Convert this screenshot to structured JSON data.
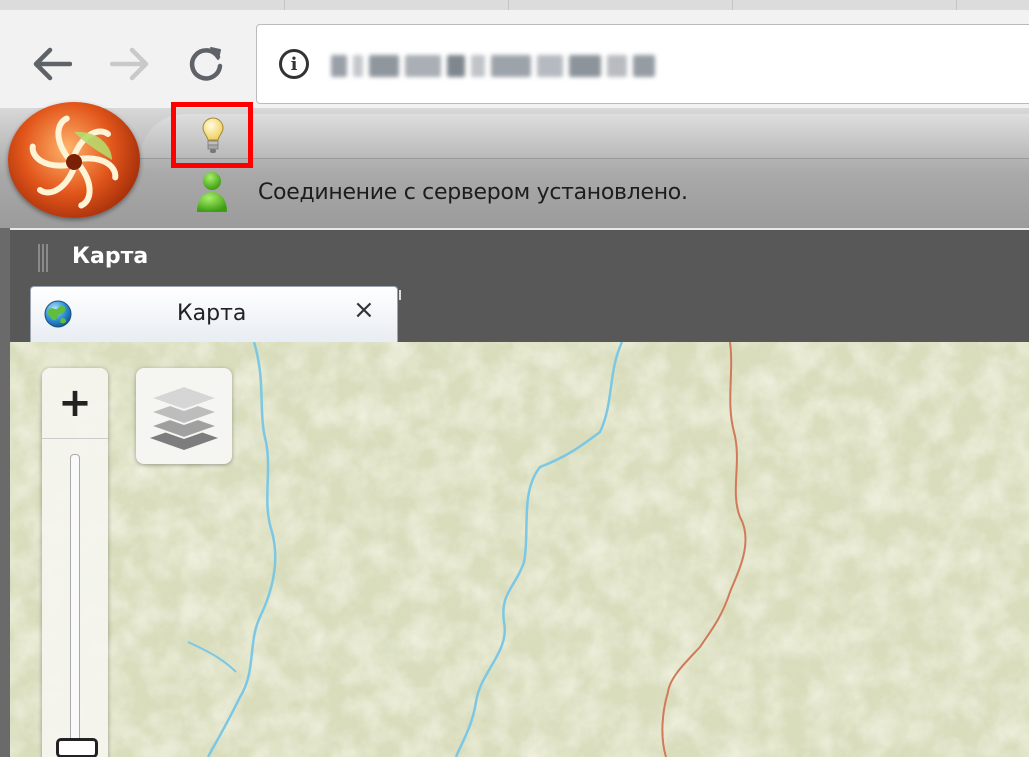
{
  "browser": {
    "back_icon": "arrow-left-icon",
    "forward_icon": "arrow-right-icon",
    "reload_icon": "reload-icon",
    "info_icon": "info-icon",
    "info_glyph": "i"
  },
  "app": {
    "logo_icon": "app-logo",
    "hint_icon": "lightbulb-icon",
    "user_icon": "user-online-icon",
    "status_text": "Соединение с сервером установлено.",
    "highlight_color": "#ff0000"
  },
  "panel": {
    "title": "Карта",
    "tab": {
      "label": "Карта",
      "close_label": "×",
      "icon": "globe-icon"
    }
  },
  "map": {
    "zoom_in_label": "+",
    "layers_icon": "layers-icon",
    "colors": {
      "background": "#dfe3c8",
      "river": "#7cc8e4",
      "border": "#d07a5a"
    }
  }
}
